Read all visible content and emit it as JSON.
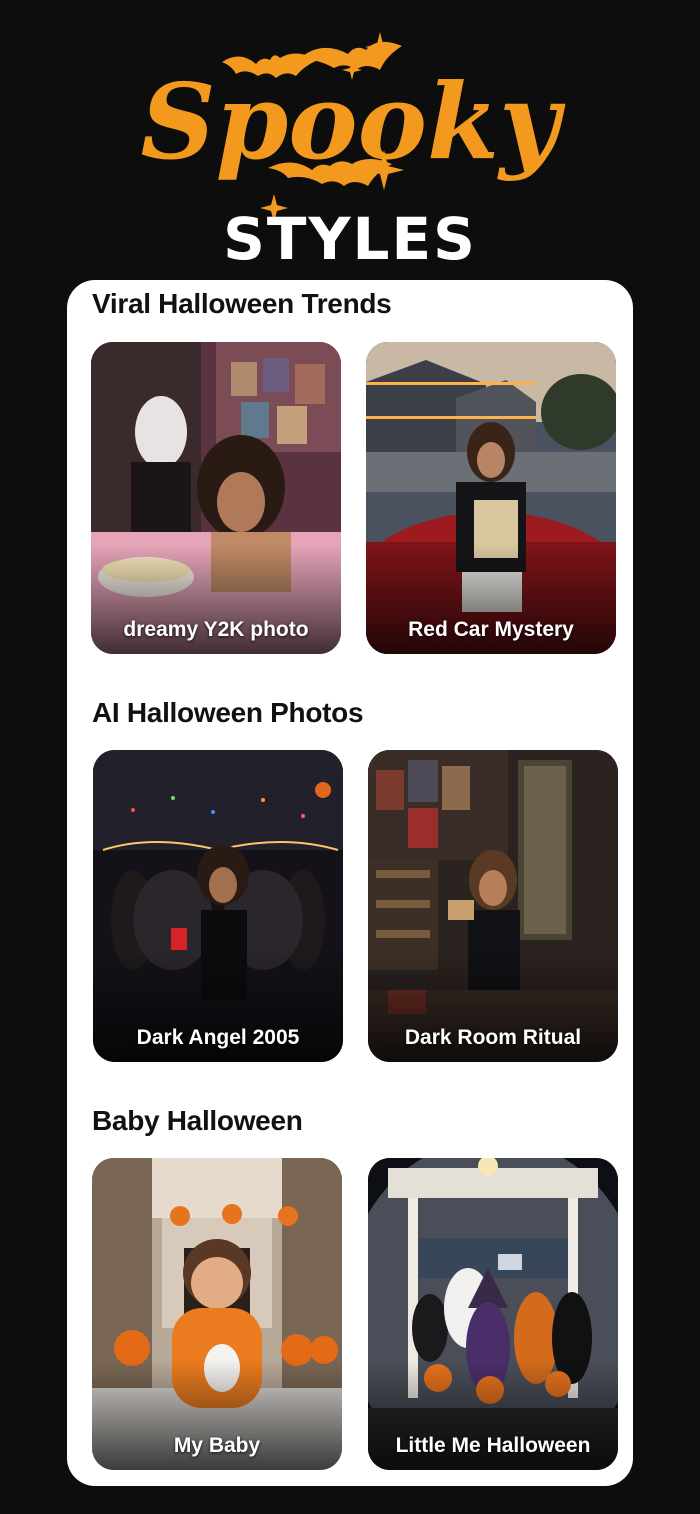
{
  "header": {
    "wordmark": "Spooky",
    "subtitle": "STYLES",
    "accent_color": "#f39a1e",
    "subtitle_color": "#ffffff"
  },
  "sections": [
    {
      "title": "Viral Halloween Trends",
      "cards": [
        {
          "label": "dreamy Y2K photo"
        },
        {
          "label": "Red Car Mystery"
        }
      ]
    },
    {
      "title": "AI Halloween Photos",
      "cards": [
        {
          "label": "Dark Angel 2005"
        },
        {
          "label": "Dark Room Ritual"
        }
      ]
    },
    {
      "title": "Baby Halloween",
      "cards": [
        {
          "label": "My Baby"
        },
        {
          "label": "Little Me Halloween"
        }
      ]
    }
  ],
  "colors": {
    "background": "#0d0d0d",
    "panel": "#ffffff",
    "title_text": "#111111",
    "card_label": "#ffffff"
  },
  "icons": [
    "bat-icon",
    "sparkle-icon"
  ]
}
